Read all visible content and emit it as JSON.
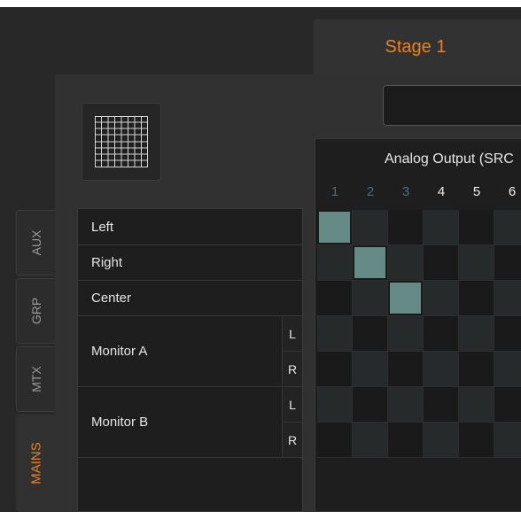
{
  "header": {
    "stage_tab": "Stage 1"
  },
  "side_tabs": [
    {
      "label": "AUX",
      "active": false
    },
    {
      "label": "GRP",
      "active": false
    },
    {
      "label": "MTX",
      "active": false
    },
    {
      "label": "MAINS",
      "active": true
    }
  ],
  "rows": [
    {
      "label": "Left"
    },
    {
      "label": "Right"
    },
    {
      "label": "Center"
    },
    {
      "label": "Monitor A",
      "channels": [
        "L",
        "R"
      ]
    },
    {
      "label": "Monitor B",
      "channels": [
        "L",
        "R"
      ]
    }
  ],
  "matrix": {
    "title": "Analog Output (SRC",
    "columns": [
      "1",
      "2",
      "3",
      "4",
      "5",
      "6"
    ],
    "routed": [
      [
        1,
        1
      ],
      [
        2,
        2
      ],
      [
        3,
        3
      ]
    ]
  },
  "colors": {
    "accent": "#e8821e",
    "active_cell": "#668a86",
    "inactive_column": "#4f6c7c"
  }
}
